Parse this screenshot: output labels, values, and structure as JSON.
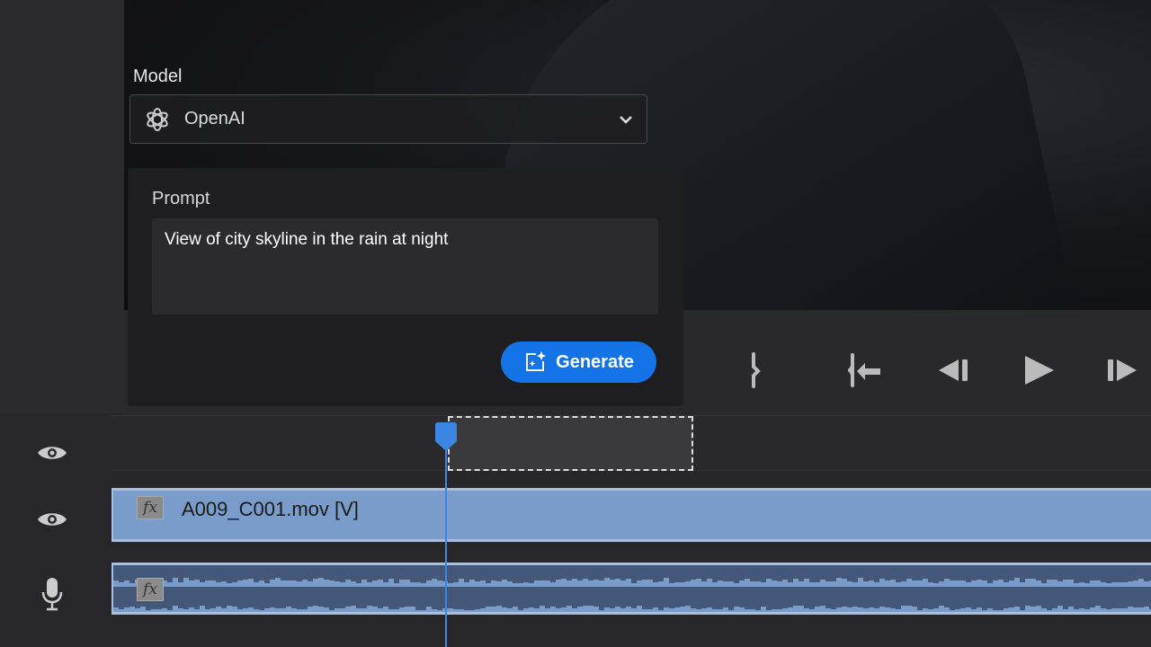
{
  "model": {
    "label": "Model",
    "selected": "OpenAI",
    "icon": "openai-logo-icon"
  },
  "prompt": {
    "label": "Prompt",
    "value": "View of city skyline in the rain at night"
  },
  "generate_button": {
    "label": "Generate",
    "icon": "generate-sparkle-icon"
  },
  "transport": [
    "mark-out-icon",
    "go-to-in-icon",
    "step-back-icon",
    "play-icon",
    "step-forward-icon"
  ],
  "timeline": {
    "video_clip": {
      "name": "A009_C001.mov [V]",
      "fx": "fx"
    },
    "audio_clip": {
      "fx": "fx"
    },
    "playhead_color": "#3b86e0",
    "clip_color": "#7a9ccb"
  }
}
